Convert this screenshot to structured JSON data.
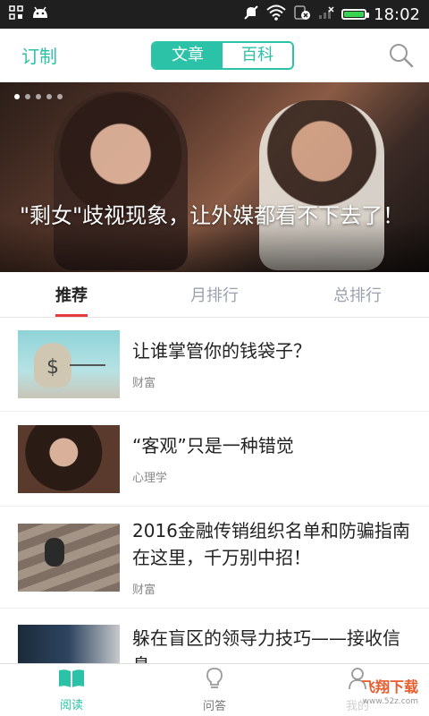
{
  "status_bar": {
    "time": "18:02",
    "battery_level": 1.0
  },
  "header": {
    "subscribe_label": "订制",
    "segments": [
      {
        "label": "文章",
        "active": true
      },
      {
        "label": "百科",
        "active": false
      }
    ]
  },
  "hero": {
    "title": "\"剩女\"歧视现象，让外媒都看不下去了！",
    "dot_count": 5
  },
  "tabs": [
    {
      "label": "推荐",
      "active": true
    },
    {
      "label": "月排行",
      "active": false
    },
    {
      "label": "总排行",
      "active": false
    }
  ],
  "articles": [
    {
      "title": "让谁掌管你的钱袋子？",
      "category": "财富"
    },
    {
      "title": "“客观”只是一种错觉",
      "category": "心理学"
    },
    {
      "title": "2016金融传销组织名单和防骗指南在这里，千万别中招！",
      "category": "财富"
    },
    {
      "title": "躲在盲区的领导力技巧——接收信息",
      "category": ""
    }
  ],
  "bottom_nav": [
    {
      "label": "阅读",
      "active": true
    },
    {
      "label": "问答",
      "active": false
    },
    {
      "label": "我的",
      "active": false
    }
  ],
  "watermark": {
    "brand": "飞翔下载",
    "site": "www.52z.com"
  },
  "colors": {
    "accent": "#2bc2a7",
    "tab_indicator": "#e63939"
  }
}
